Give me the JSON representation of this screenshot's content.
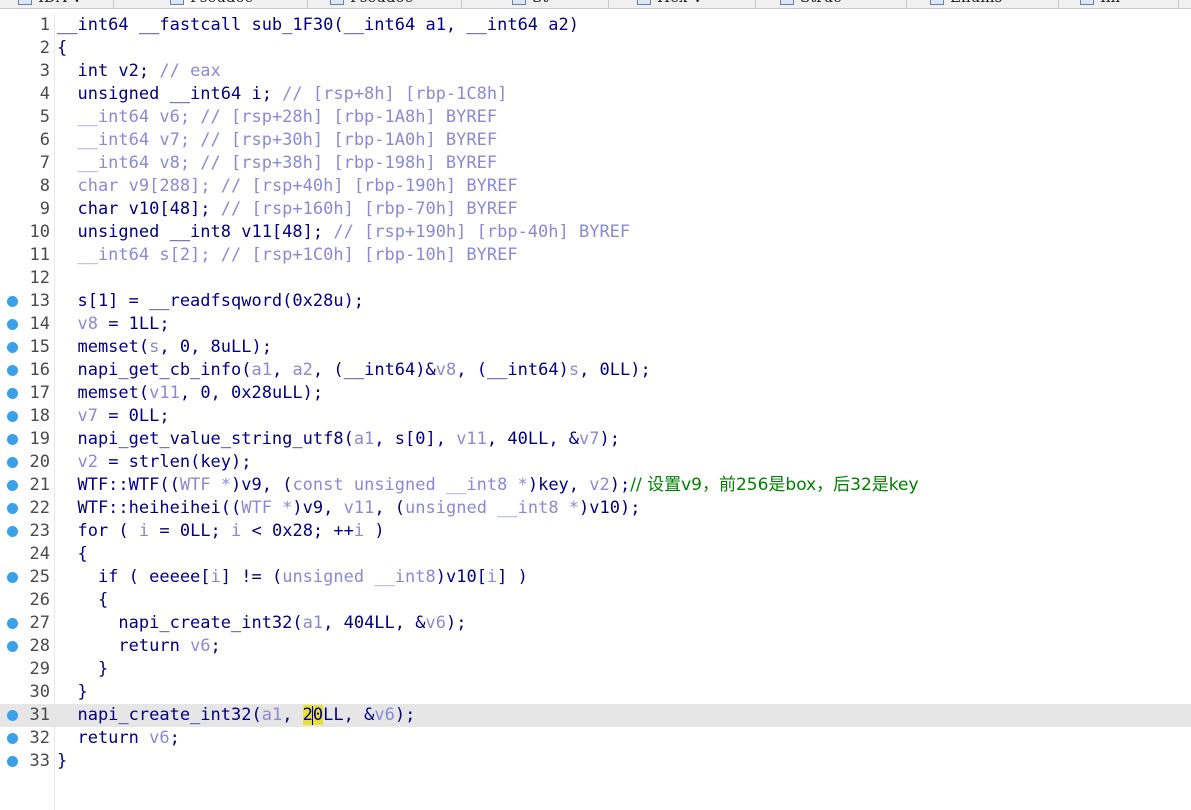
{
  "tabs": [
    {
      "label": "IDA V",
      "close_active": false
    },
    {
      "label": "Pseudoc",
      "close_active": true
    },
    {
      "label": "Pseudoc",
      "close_active": false
    },
    {
      "label": "St",
      "close_active": false
    },
    {
      "label": "Hex V",
      "close_active": false
    },
    {
      "label": "Struc",
      "close_active": false
    },
    {
      "label": "Enums",
      "close_active": false
    },
    {
      "label": "Im",
      "close_active": false
    }
  ],
  "selected_line": 31,
  "lines": [
    {
      "n": "1",
      "bp": false,
      "segs": [
        [
          "__int64 __fastcall sub_1F30(__int64 a1, __int64 a2)",
          ""
        ]
      ]
    },
    {
      "n": "2",
      "bp": false,
      "segs": [
        [
          "{",
          ""
        ]
      ]
    },
    {
      "n": "3",
      "bp": false,
      "segs": [
        [
          "  int v2; ",
          ""
        ],
        [
          "// eax",
          "c"
        ]
      ]
    },
    {
      "n": "4",
      "bp": false,
      "segs": [
        [
          "  unsigned __int64 i; ",
          ""
        ],
        [
          "// [rsp+8h] [rbp-1C8h]",
          "c"
        ]
      ]
    },
    {
      "n": "5",
      "bp": false,
      "segs": [
        [
          "  __int64 v6; ",
          "v"
        ],
        [
          "// [rsp+28h] [rbp-1A8h] BYREF",
          "c"
        ]
      ]
    },
    {
      "n": "6",
      "bp": false,
      "segs": [
        [
          "  __int64 v7; ",
          "v"
        ],
        [
          "// [rsp+30h] [rbp-1A0h] BYREF",
          "c"
        ]
      ]
    },
    {
      "n": "7",
      "bp": false,
      "segs": [
        [
          "  __int64 v8; ",
          "v"
        ],
        [
          "// [rsp+38h] [rbp-198h] BYREF",
          "c"
        ]
      ]
    },
    {
      "n": "8",
      "bp": false,
      "segs": [
        [
          "  char v9[288]; ",
          "v"
        ],
        [
          "// [rsp+40h] [rbp-190h] BYREF",
          "c"
        ]
      ]
    },
    {
      "n": "9",
      "bp": false,
      "segs": [
        [
          "  char v10[48]; ",
          ""
        ],
        [
          "// [rsp+160h] [rbp-70h] BYREF",
          "c"
        ]
      ]
    },
    {
      "n": "10",
      "bp": false,
      "segs": [
        [
          "  unsigned __int8 v11[48]; ",
          ""
        ],
        [
          "// [rsp+190h] [rbp-40h] BYREF",
          "c"
        ]
      ]
    },
    {
      "n": "11",
      "bp": false,
      "segs": [
        [
          "  __int64 s[2]; ",
          "v"
        ],
        [
          "// [rsp+1C0h] [rbp-10h] BYREF",
          "c"
        ]
      ]
    },
    {
      "n": "12",
      "bp": false,
      "segs": [
        [
          "",
          ""
        ]
      ]
    },
    {
      "n": "13",
      "bp": true,
      "segs": [
        [
          "  s[1] = __readfsqword(0x28u);",
          ""
        ]
      ]
    },
    {
      "n": "14",
      "bp": true,
      "segs": [
        [
          "  ",
          ""
        ],
        [
          "v8",
          "v"
        ],
        [
          " = 1LL;",
          ""
        ]
      ]
    },
    {
      "n": "15",
      "bp": true,
      "segs": [
        [
          "  memset(",
          ""
        ],
        [
          "s",
          "v"
        ],
        [
          ", 0, 8uLL);",
          ""
        ]
      ]
    },
    {
      "n": "16",
      "bp": true,
      "segs": [
        [
          "  napi_get_cb_info(",
          ""
        ],
        [
          "a1",
          "v"
        ],
        [
          ", ",
          ""
        ],
        [
          "a2",
          "v"
        ],
        [
          ", (__int64)&",
          ""
        ],
        [
          "v8",
          "v"
        ],
        [
          ", (__int64)",
          ""
        ],
        [
          "s",
          "v"
        ],
        [
          ", 0LL);",
          ""
        ]
      ]
    },
    {
      "n": "17",
      "bp": true,
      "segs": [
        [
          "  memset(",
          ""
        ],
        [
          "v11",
          "v"
        ],
        [
          ", 0, 0x28uLL);",
          ""
        ]
      ]
    },
    {
      "n": "18",
      "bp": true,
      "segs": [
        [
          "  ",
          ""
        ],
        [
          "v7",
          "v"
        ],
        [
          " = 0LL;",
          ""
        ]
      ]
    },
    {
      "n": "19",
      "bp": true,
      "segs": [
        [
          "  napi_get_value_string_utf8(",
          ""
        ],
        [
          "a1",
          "v"
        ],
        [
          ", s[0], ",
          ""
        ],
        [
          "v11",
          "v"
        ],
        [
          ", 40LL, &",
          ""
        ],
        [
          "v7",
          "v"
        ],
        [
          ");",
          ""
        ]
      ]
    },
    {
      "n": "20",
      "bp": true,
      "segs": [
        [
          "  ",
          ""
        ],
        [
          "v2",
          "v"
        ],
        [
          " = strlen(key);",
          ""
        ]
      ]
    },
    {
      "n": "21",
      "bp": true,
      "segs": [
        [
          "  WTF::WTF((",
          ""
        ],
        [
          "WTF *",
          "v"
        ],
        [
          ")v9, (",
          ""
        ],
        [
          "const unsigned __int8 *",
          "v"
        ],
        [
          ")key, ",
          ""
        ],
        [
          "v2",
          "v"
        ],
        [
          ");",
          ""
        ],
        [
          "// 设置v9，前256是box，后32是key",
          "cm"
        ]
      ]
    },
    {
      "n": "22",
      "bp": true,
      "segs": [
        [
          "  WTF::heiheihei((",
          ""
        ],
        [
          "WTF *",
          "v"
        ],
        [
          ")v9, ",
          ""
        ],
        [
          "v11",
          "v"
        ],
        [
          ", (",
          ""
        ],
        [
          "unsigned __int8 *",
          "v"
        ],
        [
          ")v10);",
          ""
        ]
      ]
    },
    {
      "n": "23",
      "bp": true,
      "segs": [
        [
          "  for ( ",
          ""
        ],
        [
          "i",
          "v"
        ],
        [
          " = 0LL; ",
          ""
        ],
        [
          "i",
          "v"
        ],
        [
          " < 0x28; ++",
          ""
        ],
        [
          "i",
          "v"
        ],
        [
          " )",
          ""
        ]
      ]
    },
    {
      "n": "24",
      "bp": false,
      "segs": [
        [
          "  {",
          ""
        ]
      ]
    },
    {
      "n": "25",
      "bp": true,
      "segs": [
        [
          "    if ( eeeee[",
          ""
        ],
        [
          "i",
          "v"
        ],
        [
          "] != (",
          ""
        ],
        [
          "unsigned __int8",
          "v"
        ],
        [
          ")v10[",
          ""
        ],
        [
          "i",
          "v"
        ],
        [
          "] )",
          ""
        ]
      ]
    },
    {
      "n": "26",
      "bp": false,
      "segs": [
        [
          "    {",
          ""
        ]
      ]
    },
    {
      "n": "27",
      "bp": true,
      "segs": [
        [
          "      napi_create_int32(",
          ""
        ],
        [
          "a1",
          "v"
        ],
        [
          ", 404LL, &",
          ""
        ],
        [
          "v6",
          "v"
        ],
        [
          ");",
          ""
        ]
      ]
    },
    {
      "n": "28",
      "bp": true,
      "segs": [
        [
          "      return ",
          ""
        ],
        [
          "v6",
          "v"
        ],
        [
          ";",
          ""
        ]
      ]
    },
    {
      "n": "29",
      "bp": false,
      "segs": [
        [
          "    }",
          ""
        ]
      ]
    },
    {
      "n": "30",
      "bp": false,
      "segs": [
        [
          "  }",
          ""
        ]
      ]
    },
    {
      "n": "31",
      "bp": true,
      "segs": [
        [
          "  napi_create_int32(",
          ""
        ],
        [
          "a1",
          "v"
        ],
        [
          ", ",
          ""
        ],
        [
          "2",
          "hlw"
        ],
        [
          "@CARET@",
          ""
        ],
        [
          "0",
          "hlw"
        ],
        [
          "LL, &",
          ""
        ],
        [
          "v6",
          "v"
        ],
        [
          ");",
          ""
        ]
      ]
    },
    {
      "n": "32",
      "bp": true,
      "segs": [
        [
          "  return ",
          ""
        ],
        [
          "v6",
          "v"
        ],
        [
          ";",
          ""
        ]
      ]
    },
    {
      "n": "33",
      "bp": true,
      "segs": [
        [
          "}",
          ""
        ]
      ]
    }
  ]
}
